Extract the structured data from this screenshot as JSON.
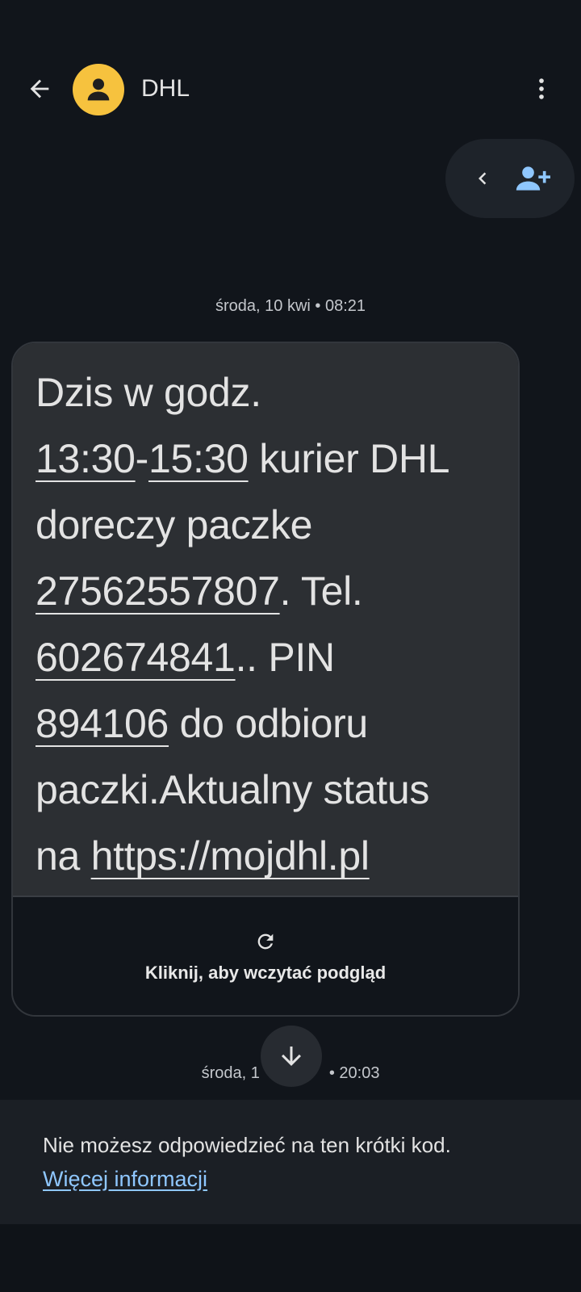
{
  "header": {
    "title": "DHL",
    "back_icon": "arrow-left-icon",
    "avatar_icon": "person-icon",
    "more_icon": "more-vert-icon",
    "avatar_color": "#f6c23e"
  },
  "pill": {
    "chevron_icon": "chevron-left-icon",
    "add_contact_icon": "person-add-icon",
    "accent": "#8fc7ff"
  },
  "conversation": {
    "timestamp_1": "środa, 10 kwi • 08:21",
    "timestamp_2_left": "środa, 1",
    "timestamp_2_right": "• 20:03",
    "message": {
      "l1": "Dzis w godz.",
      "time_start": "13:30",
      "dash": "-",
      "time_end": "15:30",
      "l2_rest": " kurier DHL",
      "l3": "doreczy paczke",
      "parcel_no": "27562557807",
      "l4_rest": ". Tel.",
      "phone": "602674841",
      "l5_rest": ".. PIN",
      "pin": "894106",
      "l6_rest": " do odbioru",
      "l7": "paczki.Aktualny status",
      "l8_pre": "na ",
      "url": "https://mojdhl.pl"
    },
    "preview": {
      "icon": "refresh-icon",
      "label": "Kliknij, aby wczytać podgląd"
    },
    "scroll_icon": "arrow-down-icon"
  },
  "reply_panel": {
    "notice": "Nie możesz odpowiedzieć na ten krótki kod.",
    "more_info": "Więcej informacji"
  }
}
